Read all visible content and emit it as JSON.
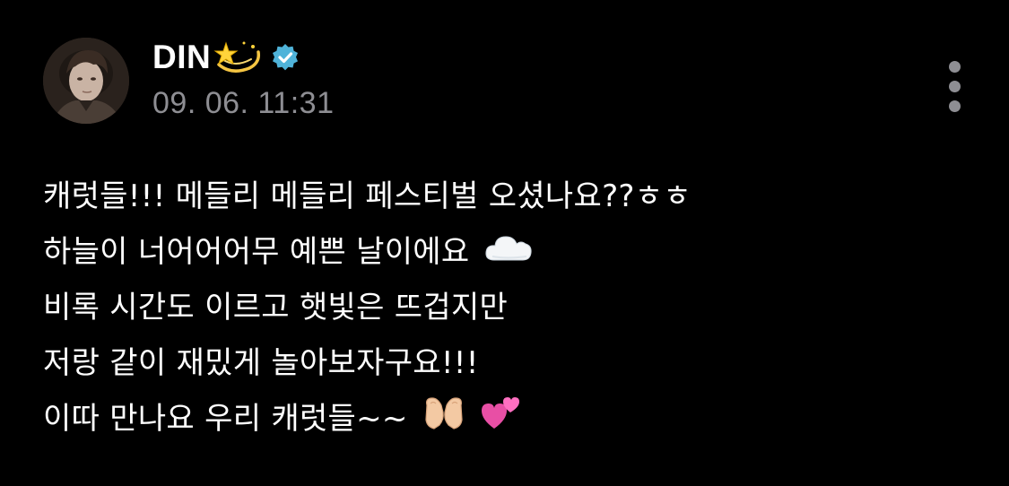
{
  "post": {
    "author": {
      "name": "DIN",
      "name_emoji": "dizzy-star-icon",
      "verified": true,
      "avatar": "profile-photo"
    },
    "timestamp": "09. 06. 11:31",
    "more_icon": "vertical-ellipsis-icon",
    "lines": [
      {
        "text": "캐럿들!!! 메들리 메들리 페스티벌 오셨나요??ㅎㅎ",
        "emoji": []
      },
      {
        "text": "하늘이 너어어어무 예쁜 날이에요",
        "emoji": [
          "cloud-icon"
        ]
      },
      {
        "text": "비록 시간도 이르고 햇빛은 뜨겁지만",
        "emoji": []
      },
      {
        "text": "저랑 같이 재밌게 놀아보자구요!!!",
        "emoji": []
      },
      {
        "text": "이따 만나요 우리 캐럿들~~",
        "emoji": [
          "heart-hands-icon",
          "two-hearts-icon"
        ]
      }
    ]
  },
  "colors": {
    "background": "#000000",
    "text": "#ffffff",
    "secondary_text": "#8e8e93",
    "verified_badge": "#4fb3d9"
  }
}
